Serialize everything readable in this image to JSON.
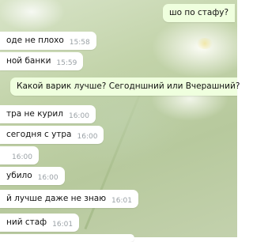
{
  "chat": {
    "messages": [
      {
        "direction": "out",
        "text": "шо по стафу?",
        "time": ""
      },
      {
        "direction": "in",
        "text": "оде не плохо",
        "time": "15:58"
      },
      {
        "direction": "in",
        "text": "ной банки",
        "time": "15:59"
      },
      {
        "direction": "out",
        "text": "Какой варик лучше? Сегодншний или Вчерашний?",
        "time": ""
      },
      {
        "direction": "in",
        "text": "тра не курил",
        "time": "16:00"
      },
      {
        "direction": "in",
        "text": "сегодня с утра",
        "time": "16:00"
      },
      {
        "direction": "in",
        "text": "",
        "time": "16:00"
      },
      {
        "direction": "in",
        "text": "убило",
        "time": "16:00"
      },
      {
        "direction": "in",
        "text": "й лучше даже не знаю",
        "time": "16:01"
      },
      {
        "direction": "in",
        "text": "ний стаф",
        "time": "16:01"
      }
    ]
  },
  "colors": {
    "incoming_bubble": "#ffffff",
    "outgoing_bubble": "#efffde",
    "timestamp": "#9aa1a6"
  }
}
